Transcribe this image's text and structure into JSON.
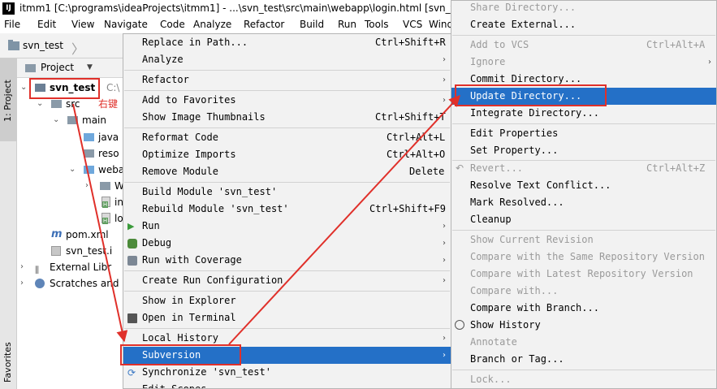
{
  "window": {
    "title": "itmm1 [C:\\programs\\ideaProjects\\itmm1] - ...\\svn_test\\src\\main\\webapp\\login.html [svn_test"
  },
  "menubar": [
    "File",
    "Edit",
    "View",
    "Navigate",
    "Code",
    "Analyze",
    "Refactor",
    "Build",
    "Run",
    "Tools",
    "VCS",
    "Wind"
  ],
  "navbar": {
    "label": "svn_test"
  },
  "left_strip": {
    "project_tab": "1: Project",
    "favorites_tab": "Favorites"
  },
  "project_panel": {
    "header": "Project",
    "tree": [
      {
        "label": "svn_test",
        "suffix": "C:\\",
        "icon": "module-folder-icon"
      },
      {
        "label": "src",
        "icon": "folder-icon"
      },
      {
        "label": "main",
        "icon": "folder-icon"
      },
      {
        "label": "java",
        "icon": "source-folder-icon"
      },
      {
        "label": "reso",
        "icon": "folder-icon"
      },
      {
        "label": "weba",
        "icon": "web-folder-icon"
      },
      {
        "label": "WE",
        "icon": "folder-icon"
      },
      {
        "label": "in",
        "icon": "html-file-icon"
      },
      {
        "label": "lo",
        "icon": "html-file-icon"
      },
      {
        "label": "pom.xml",
        "icon": "maven-icon"
      },
      {
        "label": "svn_test.i",
        "icon": "iml-file-icon"
      },
      {
        "label": "External Libr",
        "icon": "libraries-icon"
      },
      {
        "label": "Scratches and",
        "icon": "scratches-icon"
      }
    ]
  },
  "annotation": {
    "text": "右键"
  },
  "context_menu": {
    "items": [
      {
        "label": "Replace in Path...",
        "shortcut": "Ctrl+Shift+R"
      },
      {
        "label": "Analyze",
        "submenu": true
      },
      {
        "label": "Refactor",
        "submenu": true
      },
      {
        "label": "Add to Favorites",
        "submenu": true
      },
      {
        "label": "Show Image Thumbnails",
        "shortcut": "Ctrl+Shift+T"
      },
      {
        "label": "Reformat Code",
        "shortcut": "Ctrl+Alt+L"
      },
      {
        "label": "Optimize Imports",
        "shortcut": "Ctrl+Alt+O"
      },
      {
        "label": "Remove Module",
        "shortcut": "Delete"
      },
      {
        "label": "Build Module 'svn_test'"
      },
      {
        "label": "Rebuild Module 'svn_test'",
        "shortcut": "Ctrl+Shift+F9"
      },
      {
        "label": "Run",
        "submenu": true,
        "icon": "run-icon"
      },
      {
        "label": "Debug",
        "submenu": true,
        "icon": "debug-icon"
      },
      {
        "label": "Run with Coverage",
        "submenu": true,
        "icon": "coverage-icon"
      },
      {
        "label": "Create Run Configuration",
        "submenu": true
      },
      {
        "label": "Show in Explorer"
      },
      {
        "label": "Open in Terminal",
        "icon": "terminal-icon"
      },
      {
        "label": "Local History",
        "submenu": true
      },
      {
        "label": "Subversion",
        "submenu": true,
        "selected": true
      },
      {
        "label": "Synchronize 'svn_test'",
        "icon": "sync-icon"
      },
      {
        "label": "Edit Scopes..."
      }
    ]
  },
  "svn_menu": {
    "items": [
      {
        "label": "Share Directory...",
        "disabled": true
      },
      {
        "label": "Create External..."
      },
      {
        "label": "Add to VCS",
        "shortcut": "Ctrl+Alt+A",
        "disabled": true
      },
      {
        "label": "Ignore",
        "submenu": true,
        "disabled": true
      },
      {
        "label": "Commit Directory..."
      },
      {
        "label": "Update Directory...",
        "selected": true
      },
      {
        "label": "Integrate Directory..."
      },
      {
        "label": "Edit Properties"
      },
      {
        "label": "Set Property..."
      },
      {
        "label": "Revert...",
        "shortcut": "Ctrl+Alt+Z",
        "disabled": true,
        "icon": "revert-icon"
      },
      {
        "label": "Resolve Text Conflict..."
      },
      {
        "label": "Mark Resolved..."
      },
      {
        "label": "Cleanup"
      },
      {
        "label": "Show Current Revision",
        "disabled": true
      },
      {
        "label": "Compare with the Same Repository Version",
        "disabled": true
      },
      {
        "label": "Compare with Latest Repository Version",
        "disabled": true
      },
      {
        "label": "Compare with...",
        "disabled": true
      },
      {
        "label": "Compare with Branch..."
      },
      {
        "label": "Show History",
        "icon": "history-icon"
      },
      {
        "label": "Annotate",
        "disabled": true
      },
      {
        "label": "Branch or Tag..."
      },
      {
        "label": "Lock...",
        "disabled": true
      }
    ]
  },
  "colors": {
    "selection": "#2470c7",
    "annotation": "#e0302a",
    "menu_bg": "#f2f2f2"
  }
}
